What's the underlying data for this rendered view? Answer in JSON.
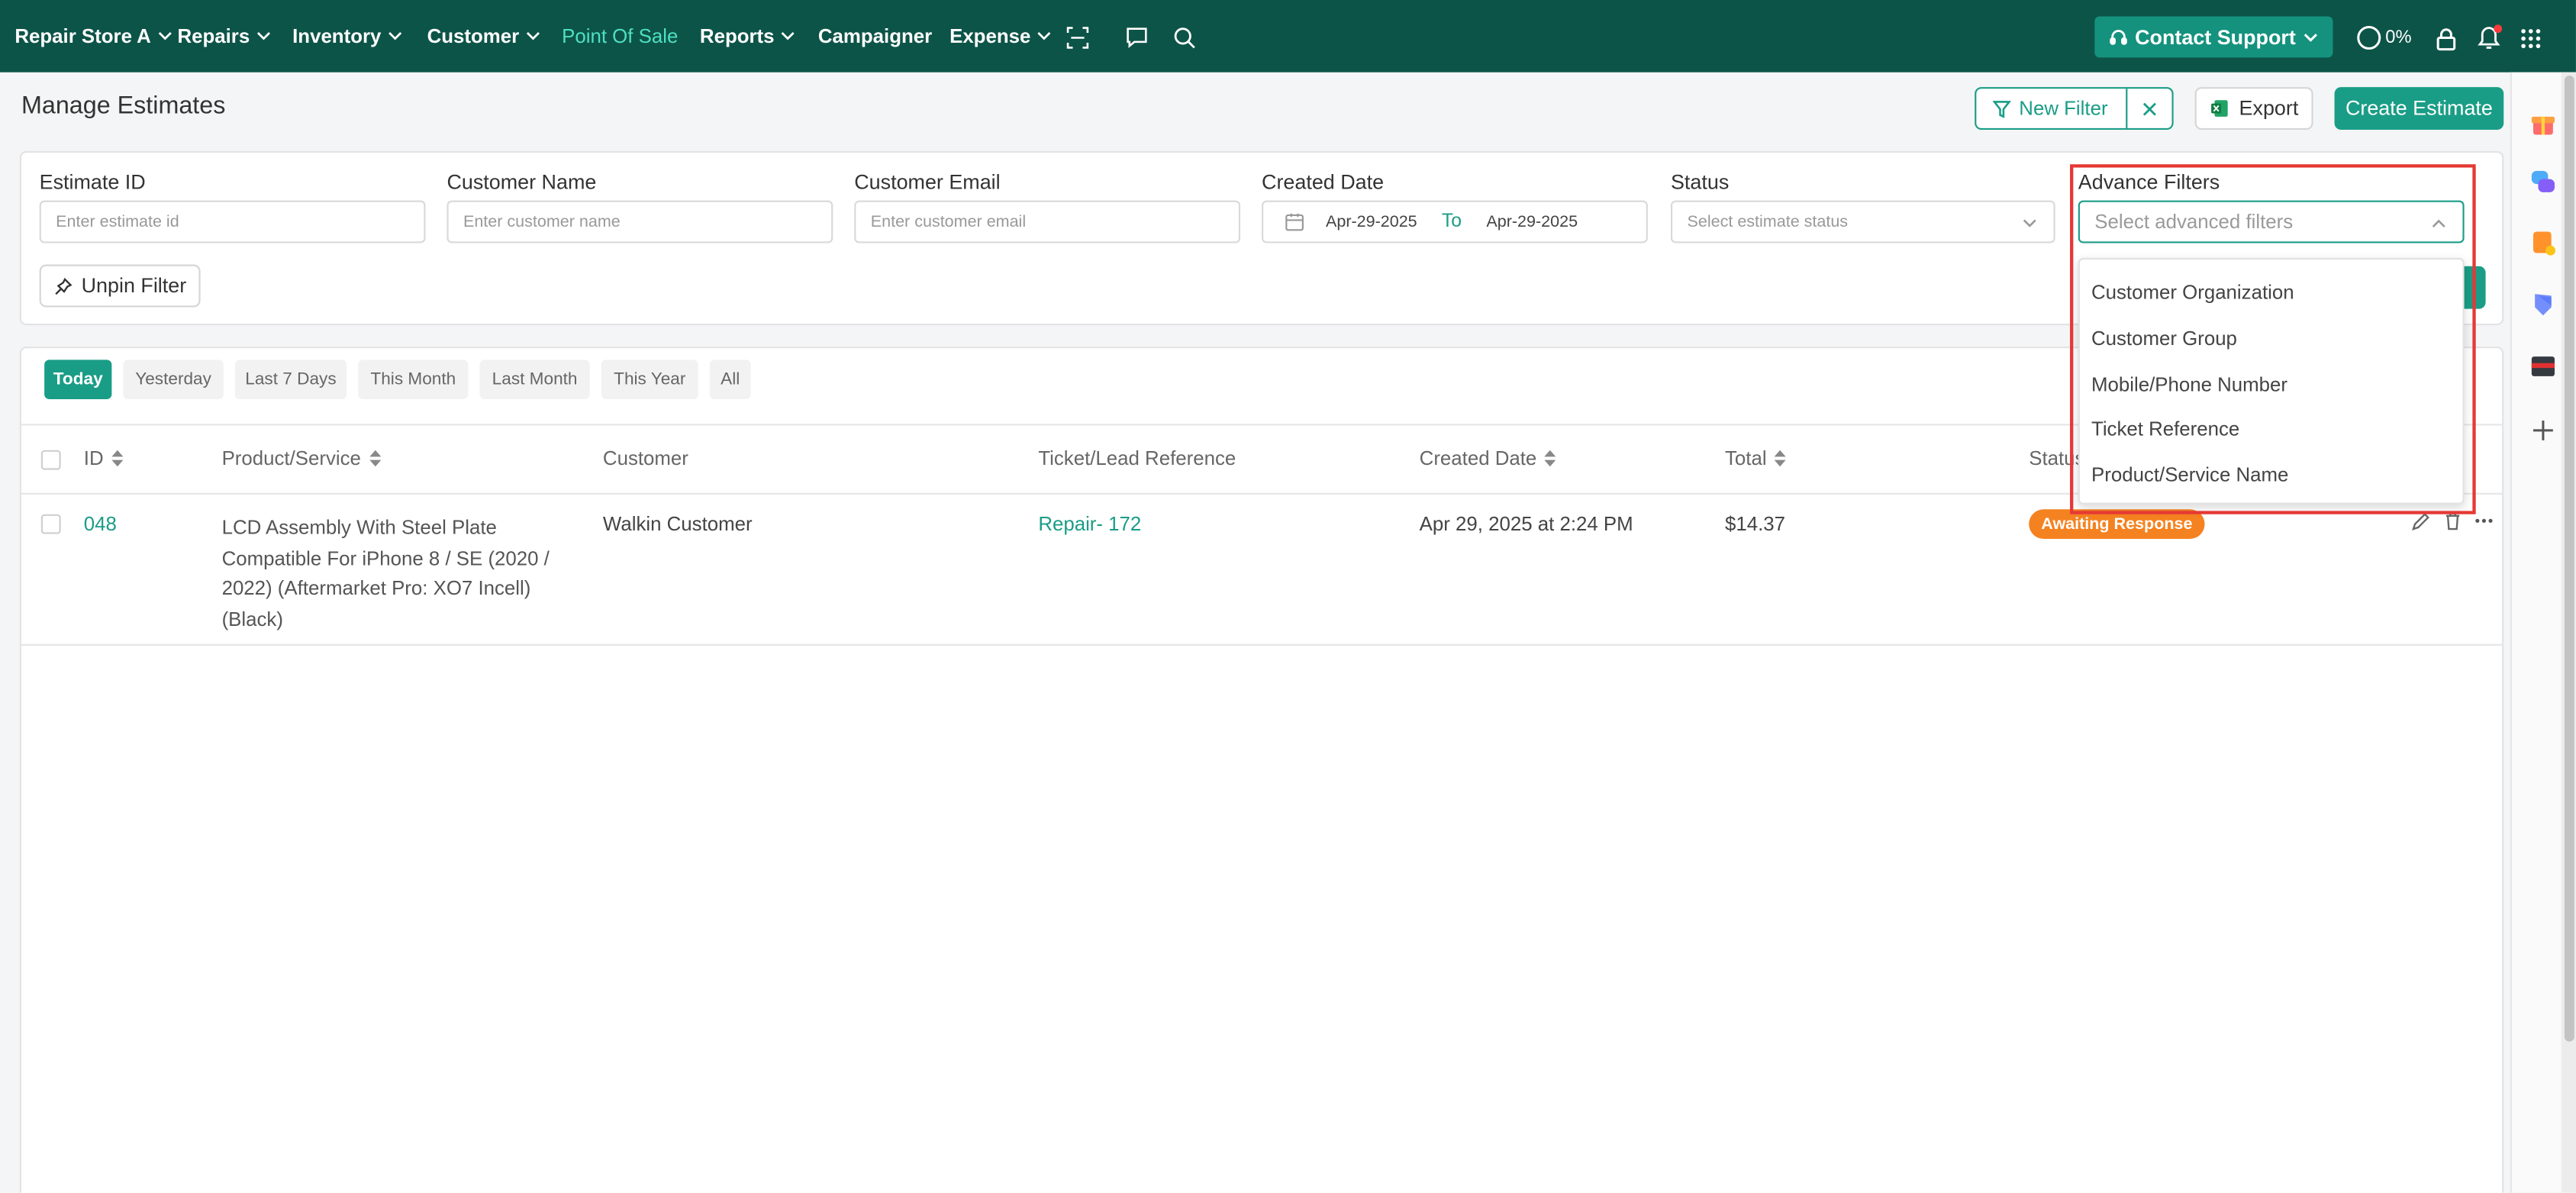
{
  "nav": {
    "items": [
      {
        "label": "Repair Store A",
        "chevron": true
      },
      {
        "label": "Repairs",
        "chevron": true
      },
      {
        "label": "Inventory",
        "chevron": true
      },
      {
        "label": "Customer",
        "chevron": true
      },
      {
        "label": "Point Of Sale",
        "chevron": false,
        "active": true
      },
      {
        "label": "Reports",
        "chevron": true
      },
      {
        "label": "Campaigner",
        "chevron": false
      },
      {
        "label": "Expense",
        "chevron": true
      }
    ],
    "icons": [
      "scan-icon",
      "chat-icon",
      "search-icon"
    ],
    "support_label": "Contact Support",
    "progress_label": "0%",
    "progress_value": 0,
    "right_icons": [
      "lock-icon",
      "bell-icon",
      "apps-grid-icon"
    ]
  },
  "page": {
    "title": "Manage Estimates",
    "new_filter_label": "New Filter",
    "export_label": "Export",
    "create_label": "Create Estimate"
  },
  "filters": {
    "estimate_id": {
      "label": "Estimate ID",
      "placeholder": "Enter estimate id"
    },
    "customer_name": {
      "label": "Customer Name",
      "placeholder": "Enter customer name"
    },
    "customer_email": {
      "label": "Customer Email",
      "placeholder": "Enter customer email"
    },
    "created_date": {
      "label": "Created Date",
      "from": "Apr-29-2025",
      "to_label": "To",
      "to": "Apr-29-2025"
    },
    "status": {
      "label": "Status",
      "placeholder": "Select estimate status"
    },
    "advance": {
      "label": "Advance Filters",
      "placeholder": "Select advanced filters",
      "options": [
        "Customer Organization",
        "Customer Group",
        "Mobile/Phone Number",
        "Ticket Reference",
        "Product/Service Name"
      ]
    },
    "unpin_label": "Unpin Filter"
  },
  "date_chips": [
    "Today",
    "Yesterday",
    "Last 7 Days",
    "This Month",
    "Last Month",
    "This Year",
    "All"
  ],
  "table": {
    "headers": {
      "id": "ID",
      "product": "Product/Service",
      "customer": "Customer",
      "ticket": "Ticket/Lead Reference",
      "created": "Created Date",
      "total": "Total",
      "status": "Status"
    },
    "rows": [
      {
        "id": "048",
        "product_lines": [
          "LCD Assembly With Steel Plate",
          "Compatible For iPhone 8 / SE (2020 /",
          "2022) (Aftermarket Pro: XO7 Incell)",
          "(Black)"
        ],
        "customer": "Walkin Customer",
        "ticket": "Repair- 172",
        "created": "Apr 29, 2025 at 2:24 PM",
        "total": "$14.37",
        "status": "Awaiting Response"
      }
    ]
  },
  "colors": {
    "nav_bg": "#0d5448",
    "accent": "#1a9d86",
    "active_nav": "#4ee0c1",
    "status_badge": "#f58220",
    "highlight": "#e53935"
  },
  "sidebar_icons": [
    "gift-icon",
    "chat-bubbles-icon",
    "notes-icon",
    "shield-icon",
    "card-icon",
    "plus-icon"
  ]
}
